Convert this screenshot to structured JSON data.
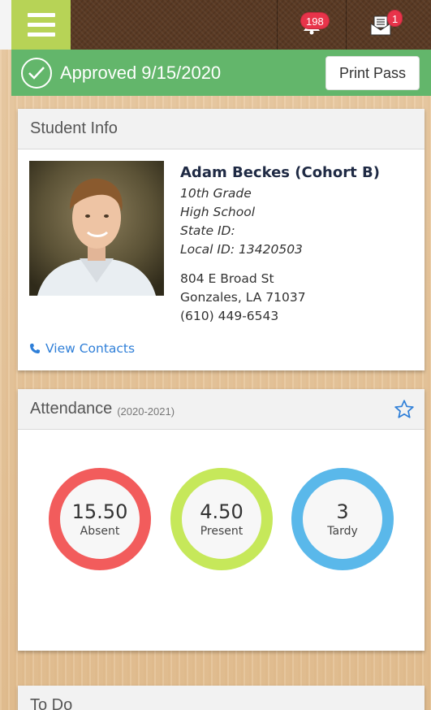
{
  "header": {
    "notifications_count": "198",
    "messages_count": "1"
  },
  "status": {
    "approved_text": "Approved 9/15/2020",
    "print_label": "Print Pass"
  },
  "student_info": {
    "title": "Student Info",
    "name": "Adam Beckes (Cohort B)",
    "grade": "10th Grade",
    "school": "High School",
    "state_id": "State ID:",
    "local_id": "Local ID: 13420503",
    "address1": "804 E Broad St",
    "address2": "Gonzales, LA 71037",
    "phone": "(610) 449-6543",
    "contacts_label": "View Contacts"
  },
  "attendance": {
    "title": "Attendance",
    "year": "(2020-2021)",
    "stats": [
      {
        "value": "15.50",
        "label": "Absent",
        "color": "#f25c5c"
      },
      {
        "value": "4.50",
        "label": "Present",
        "color": "#c6e85a"
      },
      {
        "value": "3",
        "label": "Tardy",
        "color": "#5ab8ea"
      }
    ]
  },
  "todo": {
    "title": "To Do"
  },
  "colors": {
    "accent_green": "#63b66b",
    "menu_green": "#b7d356",
    "badge_red": "#e8344a",
    "link_blue": "#2f7fd8"
  }
}
